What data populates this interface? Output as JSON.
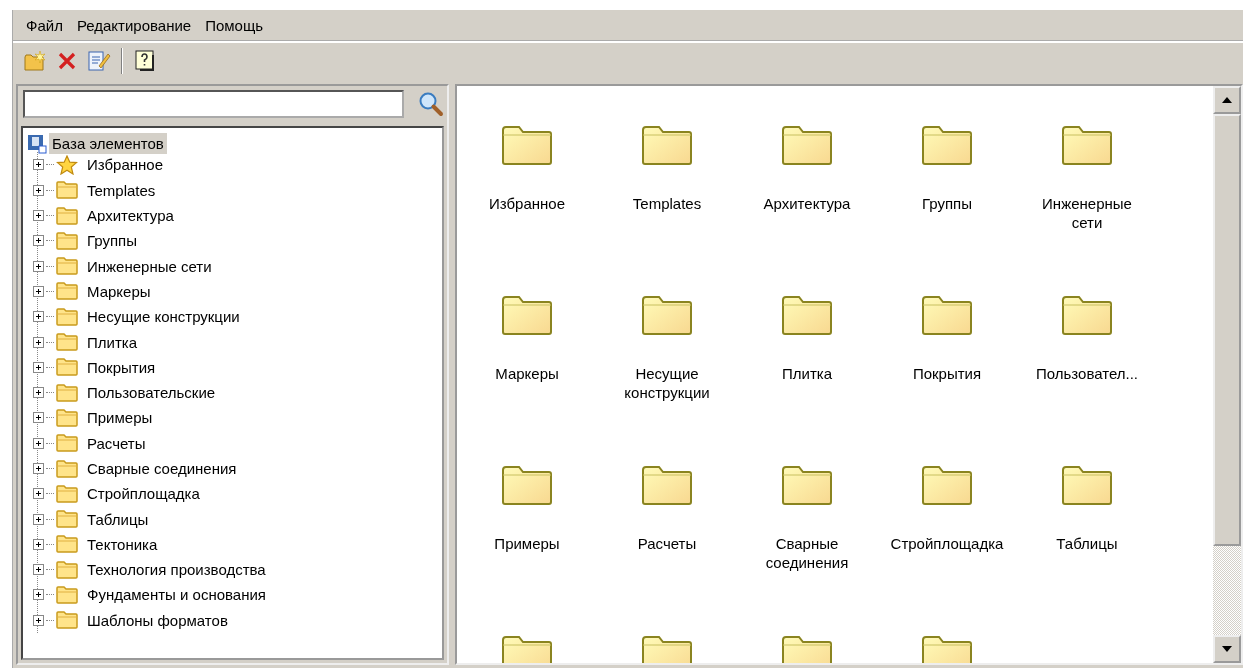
{
  "menu": [
    {
      "label": "Файл"
    },
    {
      "label": "Редактирование"
    },
    {
      "label": "Помощь"
    }
  ],
  "toolbar": [
    {
      "kind": "new-folder"
    },
    {
      "kind": "delete"
    },
    {
      "kind": "edit"
    },
    {
      "kind": "separator"
    },
    {
      "kind": "help"
    }
  ],
  "tree": {
    "label": "База элементов",
    "kind": "database",
    "selected": true,
    "expanded": true,
    "children": [
      {
        "label": "Избранное",
        "kind": "star",
        "expanded": false
      },
      {
        "label": "Templates",
        "kind": "folder",
        "expanded": false
      },
      {
        "label": "Архитектура",
        "kind": "folder",
        "expanded": false
      },
      {
        "label": "Группы",
        "kind": "folder",
        "expanded": false
      },
      {
        "label": "Инженерные сети",
        "kind": "folder",
        "expanded": false
      },
      {
        "label": "Маркеры",
        "kind": "folder",
        "expanded": false
      },
      {
        "label": "Несущие конструкции",
        "kind": "folder",
        "expanded": false
      },
      {
        "label": "Плитка",
        "kind": "folder",
        "expanded": false
      },
      {
        "label": "Покрытия",
        "kind": "folder",
        "expanded": false
      },
      {
        "label": "Пользовательские",
        "kind": "folder",
        "expanded": false
      },
      {
        "label": "Примеры",
        "kind": "folder",
        "expanded": false
      },
      {
        "label": "Расчеты",
        "kind": "folder",
        "expanded": false
      },
      {
        "label": "Сварные соединения",
        "kind": "folder",
        "expanded": false
      },
      {
        "label": "Стройплощадка",
        "kind": "folder",
        "expanded": false
      },
      {
        "label": "Таблицы",
        "kind": "folder",
        "expanded": false
      },
      {
        "label": "Тектоника",
        "kind": "folder",
        "expanded": false
      },
      {
        "label": "Технология производства",
        "kind": "folder",
        "expanded": false
      },
      {
        "label": "Фундаменты и основания",
        "kind": "folder",
        "expanded": false
      },
      {
        "label": "Шаблоны форматов",
        "kind": "folder",
        "expanded": false
      }
    ]
  },
  "grid": {
    "items": [
      {
        "kind": "folder",
        "label": "Избранное"
      },
      {
        "kind": "folder",
        "label": "Templates"
      },
      {
        "kind": "folder",
        "label": "Архитектура"
      },
      {
        "kind": "folder",
        "label": "Группы"
      },
      {
        "kind": "folder",
        "label": "Инженерные сети"
      },
      {
        "kind": "folder",
        "label": "Маркеры"
      },
      {
        "kind": "folder",
        "label": "Несущие конструкции"
      },
      {
        "kind": "folder",
        "label": "Плитка"
      },
      {
        "kind": "folder",
        "label": "Покрытия"
      },
      {
        "kind": "folder",
        "label": "Пользовател..."
      },
      {
        "kind": "folder",
        "label": "Примеры"
      },
      {
        "kind": "folder",
        "label": "Расчеты"
      },
      {
        "kind": "folder",
        "label": "Сварные соединения"
      },
      {
        "kind": "folder",
        "label": "Стройплощадка"
      },
      {
        "kind": "folder",
        "label": "Таблицы"
      },
      {
        "kind": "folder"
      },
      {
        "kind": "folder"
      },
      {
        "kind": "folder"
      },
      {
        "kind": "folder"
      }
    ]
  }
}
